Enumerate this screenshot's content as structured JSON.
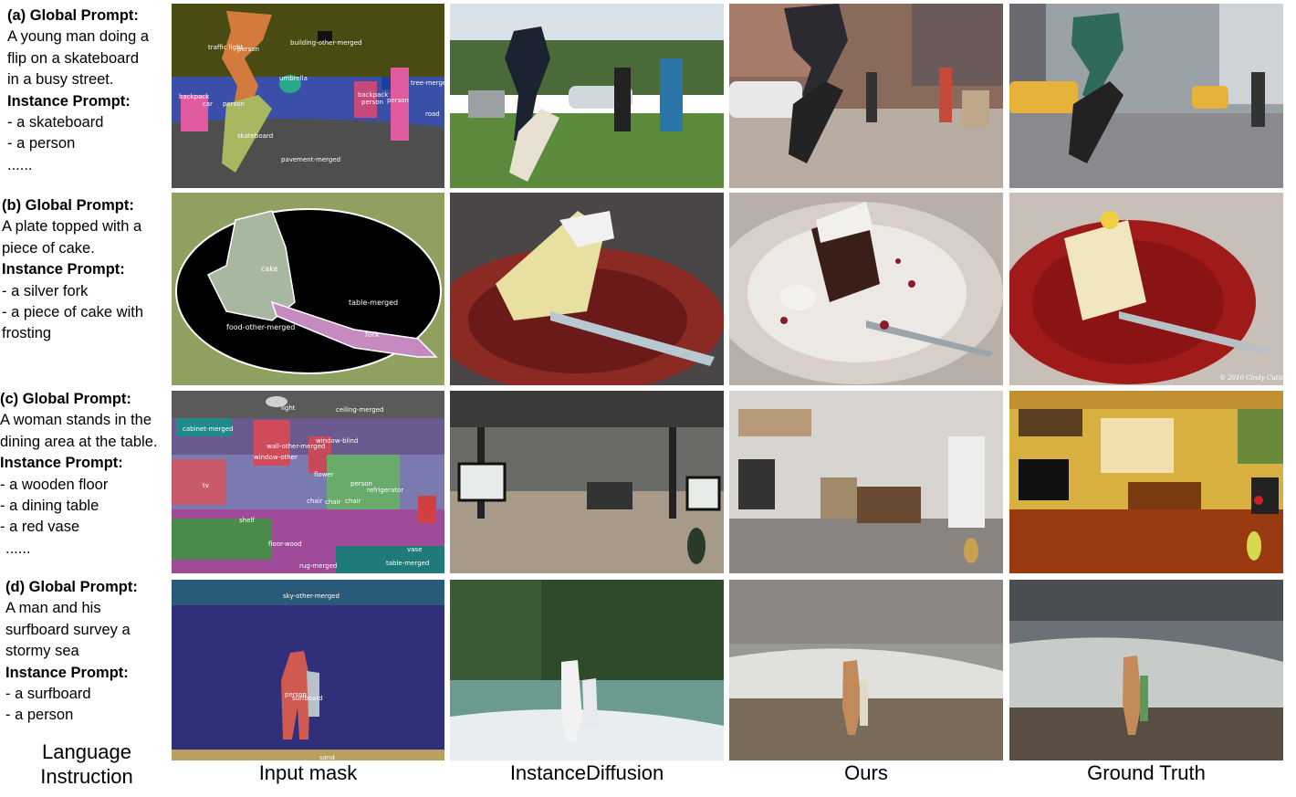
{
  "rows": [
    {
      "tag": "(a) Global Prompt:",
      "global_lines": [
        "A young man doing a",
        "flip on a skateboard",
        "in a busy street."
      ],
      "instance_title": "Instance Prompt:",
      "instance_lines": [
        "- a skateboard",
        "- a person",
        "......"
      ],
      "mask_labels": [
        "building-other-merged",
        "person",
        "traffic light",
        "umbrella",
        "tree-merged",
        "backpack",
        "car",
        "person",
        "person",
        "skateboard",
        "pavement-merged",
        "road",
        "backpack",
        "person"
      ]
    },
    {
      "tag": "(b) Global Prompt:",
      "global_lines": [
        "A plate topped with a",
        "piece of cake."
      ],
      "instance_title": "Instance Prompt:",
      "instance_lines": [
        "- a silver fork",
        "- a piece of cake with",
        "frosting"
      ],
      "mask_labels": [
        "cake",
        "table-merged",
        "food-other-merged",
        "fork"
      ]
    },
    {
      "tag": "(c) Global Prompt:",
      "global_lines": [
        "A woman stands in the",
        "dining area at the table."
      ],
      "instance_title": "Instance Prompt:",
      "instance_lines": [
        "- a wooden floor",
        "- a dining table",
        "- a red vase",
        "......"
      ],
      "mask_labels": [
        "light",
        "ceiling-merged",
        "cabinet-merged",
        "window-blind",
        "wall-other-merged",
        "window-other",
        "flower",
        "person",
        "refrigerator",
        "tv",
        "chair",
        "chair",
        "chair",
        "shelf",
        "floor-wood",
        "rug-merged",
        "vase",
        "table-merged"
      ]
    },
    {
      "tag": "(d) Global Prompt:",
      "global_lines": [
        "A man and his",
        "surfboard survey a",
        "stormy sea"
      ],
      "instance_title": "Instance Prompt:",
      "instance_lines": [
        "- a surfboard",
        "- a person"
      ],
      "mask_labels": [
        "sky-other-merged",
        "person",
        "surfboard",
        "sand"
      ]
    }
  ],
  "column_labels": {
    "language": [
      "Language",
      "Instruction"
    ],
    "mask": "Input mask",
    "instancediffusion": "InstanceDiffusion",
    "ours": "Ours",
    "gt": "Ground Truth"
  },
  "watermark": "© 2010 Cindy Cutlo"
}
